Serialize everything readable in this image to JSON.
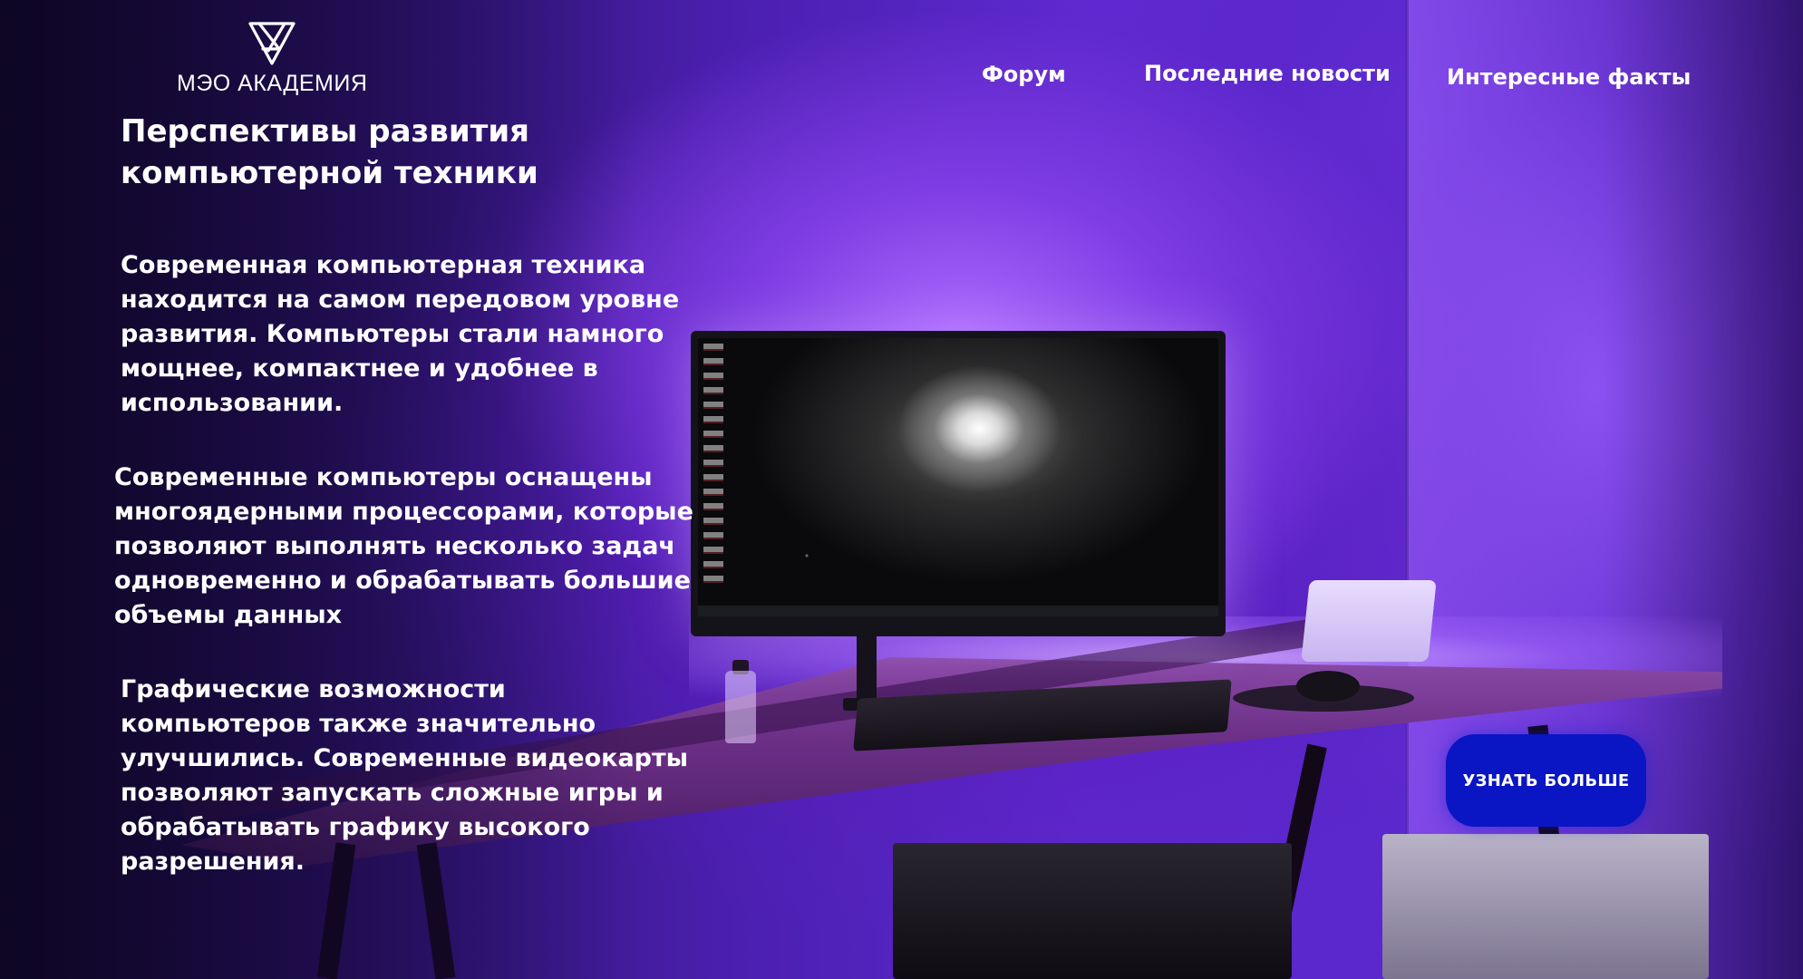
{
  "brand": {
    "logo_icon": "triangle-knot-icon",
    "name": "МЭО АКАДЕМИЯ"
  },
  "nav": {
    "items": [
      {
        "label": "Форум"
      },
      {
        "label": "Последние новости"
      },
      {
        "label": "Интересные факты"
      }
    ]
  },
  "hero": {
    "title": "Перспективы развития компьютерной техники",
    "paragraphs": [
      "Современная компьютерная техника находится на самом передовом уровне развития. Компьютеры стали намного мощнее, компактнее и удобнее в использовании.",
      "Современные компьютеры оснащены многоядерными процессорами, которые позволяют выполнять несколько задач одновременно и обрабатывать большие объемы данных",
      "Графические возможности компьютеров также значительно улучшились. Современные видеокарты позволяют запускать сложные игры и обрабатывать графику высокого разрешения."
    ]
  },
  "cta": {
    "label": "УЗНАТЬ БОЛЬШЕ"
  },
  "colors": {
    "accent_button": "#0a16c4",
    "background_glow": "#5e29d0",
    "text": "#ffffff"
  }
}
